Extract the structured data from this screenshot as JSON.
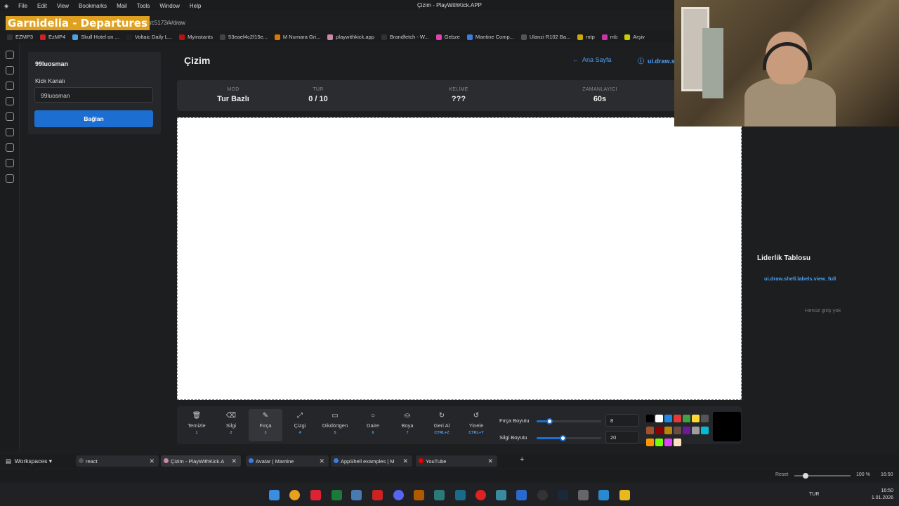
{
  "menu": [
    "File",
    "Edit",
    "View",
    "Bookmarks",
    "Mail",
    "Tools",
    "Window",
    "Help"
  ],
  "window_title": "Çizim - PlayWithKick.APP",
  "overlay_title": "Garnidelia - Departures",
  "url": "localhost:5173/#/draw",
  "bookmarks": [
    {
      "label": "EZMP3",
      "color": "#333"
    },
    {
      "label": "EzMP4",
      "color": "#c22"
    },
    {
      "label": "Skull Hotel on ...",
      "color": "#4aa3e0"
    },
    {
      "label": "Voltaic Daily L...",
      "color": "#222"
    },
    {
      "label": "Myinstants",
      "color": "#b11"
    },
    {
      "label": "53eaef4c2f15e...",
      "color": "#444"
    },
    {
      "label": "M Numara Gri...",
      "color": "#d70"
    },
    {
      "label": "playwithkick.app",
      "color": "#c8a"
    },
    {
      "label": "Brandfetch - W...",
      "color": "#333"
    },
    {
      "label": "Gebze",
      "color": "#d4a"
    },
    {
      "label": "Mantine Comp...",
      "color": "#3a7de0"
    },
    {
      "label": "Ulanzi R102 Ba...",
      "color": "#555"
    },
    {
      "label": "mtp",
      "color": "#ca0"
    },
    {
      "label": "mb",
      "color": "#c3a"
    },
    {
      "label": "Arşiv",
      "color": "#cc0"
    }
  ],
  "left_panel": {
    "username": "99luosman",
    "kick_label": "Kick Kanalı",
    "kick_value": "99luosman",
    "connect_button": "Bağlan"
  },
  "main": {
    "title": "Çizim",
    "home_link": "Ana Sayfa",
    "help_link": "ui.draw.s",
    "stats": [
      {
        "label": "MOD",
        "value": "Tur Bazlı"
      },
      {
        "label": "TUR",
        "value": "0 / 10"
      },
      {
        "label": "KELİME",
        "value": "???"
      },
      {
        "label": "ZAMANLAYICI",
        "value": "60s"
      }
    ]
  },
  "tools": [
    {
      "label": "Temizle",
      "key": "1",
      "icon": "🗑"
    },
    {
      "label": "Silgi",
      "key": "2",
      "icon": "⌫"
    },
    {
      "label": "Fırça",
      "key": "3",
      "icon": "✎"
    },
    {
      "label": "Çizgi",
      "key": "4",
      "icon": "⤢"
    },
    {
      "label": "Dikdörtgen",
      "key": "5",
      "icon": "▭"
    },
    {
      "label": "Daire",
      "key": "6",
      "icon": "○"
    },
    {
      "label": "Boya",
      "key": "7",
      "icon": "⛀"
    },
    {
      "label": "Geri Al",
      "key": "CTRL+Z",
      "icon": "↻"
    },
    {
      "label": "Yinele",
      "key": "CTRL+Y",
      "icon": "↺"
    }
  ],
  "active_tool": "Fırça",
  "brush": {
    "label": "Fırça Boyutu",
    "value": "8",
    "fraction": 0.2
  },
  "eraser": {
    "label": "Silgi Boyutu",
    "value": "20",
    "fraction": 0.4
  },
  "colors": [
    "#000000",
    "#ffffff",
    "#1e88e5",
    "#e53935",
    "#43a047",
    "#fdd835",
    "#555555",
    "#a0522d",
    "#8b0000",
    "#b8860b",
    "#6d4c41",
    "#6a1b9a",
    "#9e9e9e",
    "#00bcd4",
    "#ff9800",
    "#76ff03",
    "#e040fb",
    "#ffe0c0"
  ],
  "selected_color": "#000000",
  "leaderboard": {
    "title": "Liderlik Tablosu",
    "link": "ui.draw.shell.labels.view_full",
    "empty": "Henüz giriş yok"
  },
  "workspaces_label": "Workspaces",
  "tabs": [
    {
      "label": "react",
      "color": "#555"
    },
    {
      "label": "Çizim - PlayWithKick.A",
      "color": "#c8a"
    },
    {
      "label": "Avatar | Mantine",
      "color": "#3a7de0"
    },
    {
      "label": "AppShell examples | M",
      "color": "#3a7de0"
    },
    {
      "label": "YouTube",
      "color": "#e00"
    }
  ],
  "status": {
    "reset": "Reset",
    "zoom": "100 %",
    "time": "16:50"
  },
  "clock": {
    "time": "16:50",
    "date": "1.01.2026",
    "lang": "TUR"
  }
}
